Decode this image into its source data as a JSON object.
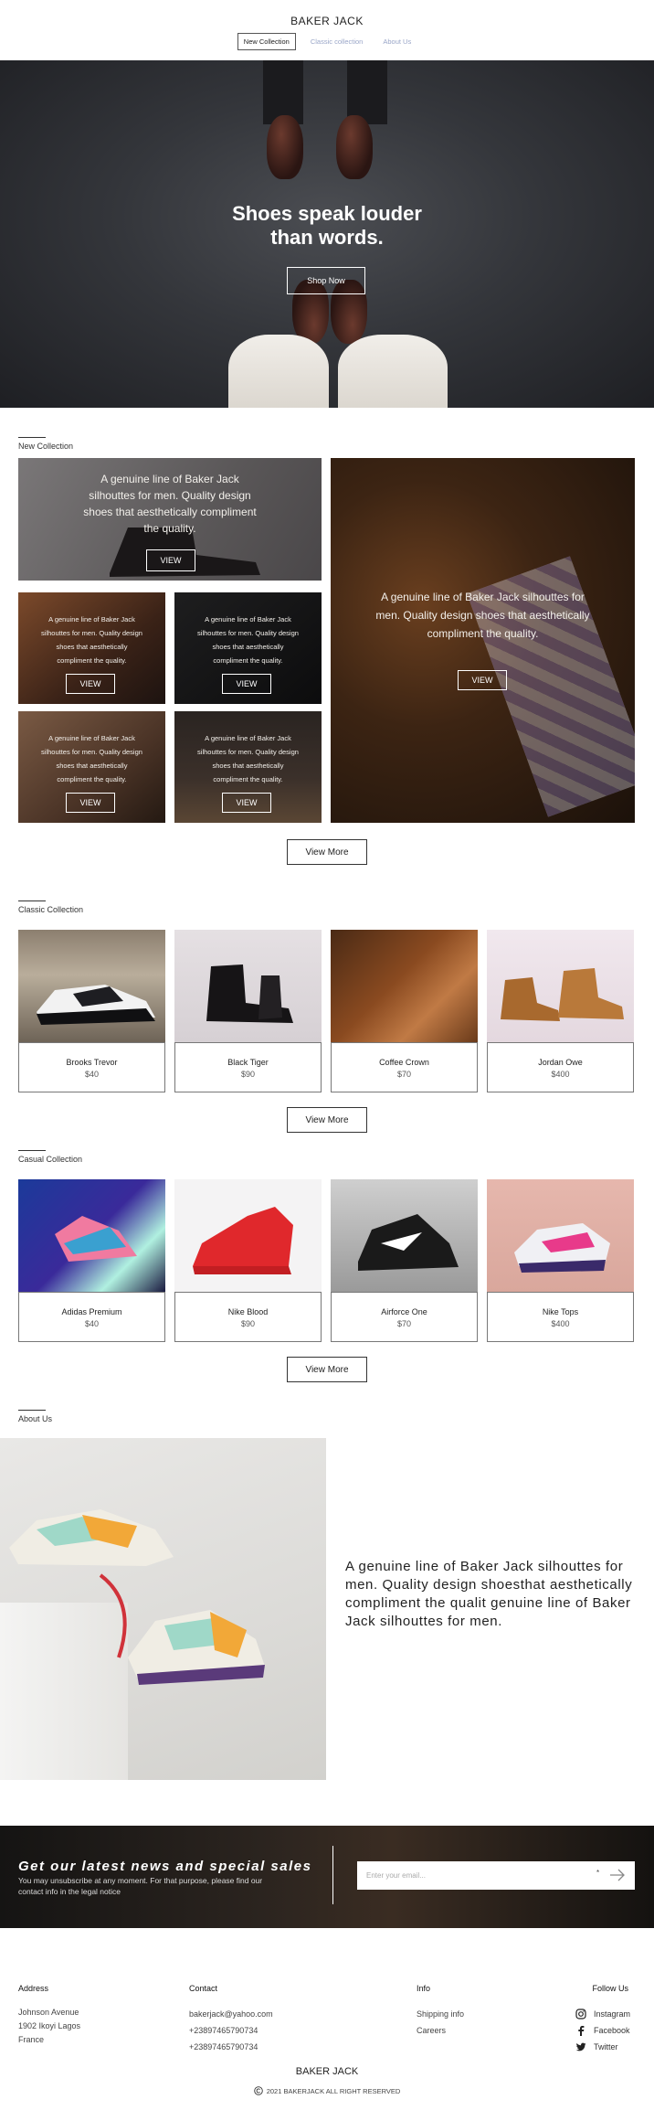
{
  "brand": "BAKER JACK",
  "nav": [
    "New Collection",
    "Classic collection",
    "About Us"
  ],
  "hero": {
    "title_line1": "Shoes speak louder",
    "title_line2": "than words.",
    "button": "Shop Now"
  },
  "new_collection": {
    "title": "New Collection",
    "tile_text": "A genuine line of Baker Jack silhouttes for men. Quality design shoes that aesthetically compliment the quality.",
    "view_label": "VIEW",
    "view_more": "View More"
  },
  "classic_collection": {
    "title": "Classic Collection",
    "items": [
      {
        "name": "Brooks Trevor",
        "price": "$40"
      },
      {
        "name": "Black Tiger",
        "price": "$90"
      },
      {
        "name": "Coffee Crown",
        "price": "$70"
      },
      {
        "name": "Jordan Owe",
        "price": "$400"
      }
    ],
    "view_more": "View More"
  },
  "casual_collection": {
    "title": "Casual Collection",
    "items": [
      {
        "name": "Adidas Premium",
        "price": "$40"
      },
      {
        "name": "Nike Blood",
        "price": "$90"
      },
      {
        "name": "Airforce One",
        "price": "$70"
      },
      {
        "name": "Nike Tops",
        "price": "$400"
      }
    ],
    "view_more": "View More"
  },
  "about": {
    "title": "About Us",
    "text": "A genuine line of Baker Jack silhouttes for men. Quality design shoesthat aesthetically compliment the qualit genuine line of Baker Jack silhouttes for men."
  },
  "newsletter": {
    "title": "Get our latest news and special sales",
    "subtitle": "You may unsubscribe at any moment. For that purpose, please find our contact info in the legal notice",
    "placeholder": "Enter your email...",
    "required_mark": "*"
  },
  "footer": {
    "address": {
      "heading": "Address",
      "lines": [
        "Johnson Avenue",
        "1902 Ikoyi Lagos",
        "France"
      ]
    },
    "contact": {
      "heading": "Contact",
      "lines": [
        "bakerjack@yahoo.com",
        "+23897465790734",
        "+23897465790734"
      ]
    },
    "info": {
      "heading": "Info",
      "links": [
        "Shipping info",
        "Careers"
      ]
    },
    "follow": {
      "heading": "Follow Us",
      "links": [
        "Instagram",
        "Facebook",
        "Twitter"
      ]
    },
    "brand": "BAKER JACK",
    "copyright": "2021 BAKERJACK ALL RIGHT RESERVED"
  },
  "colors": {
    "nav_inactive": "#9aa6c8",
    "text": "#222222"
  }
}
